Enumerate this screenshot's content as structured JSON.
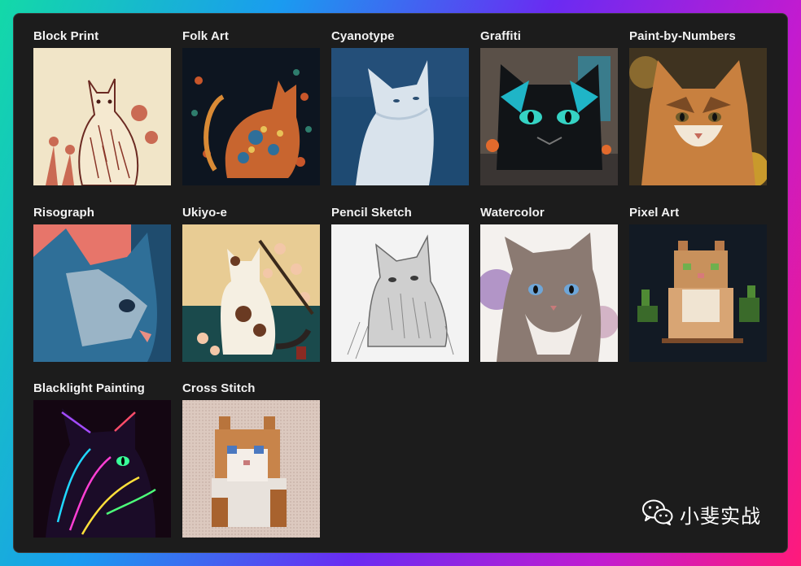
{
  "gallery": {
    "items": [
      {
        "label": "Block Print"
      },
      {
        "label": "Folk Art"
      },
      {
        "label": "Cyanotype"
      },
      {
        "label": "Graffiti"
      },
      {
        "label": "Paint-by-Numbers"
      },
      {
        "label": "Risograph"
      },
      {
        "label": "Ukiyo-e"
      },
      {
        "label": "Pencil Sketch"
      },
      {
        "label": "Watercolor"
      },
      {
        "label": "Pixel Art"
      },
      {
        "label": "Blacklight Painting"
      },
      {
        "label": "Cross Stitch"
      }
    ]
  },
  "watermark": {
    "text": "小斐实战",
    "icon": "wechat-icon"
  },
  "colors": {
    "panel_bg": "#1c1c1c",
    "label_text": "#f2f2f2"
  }
}
